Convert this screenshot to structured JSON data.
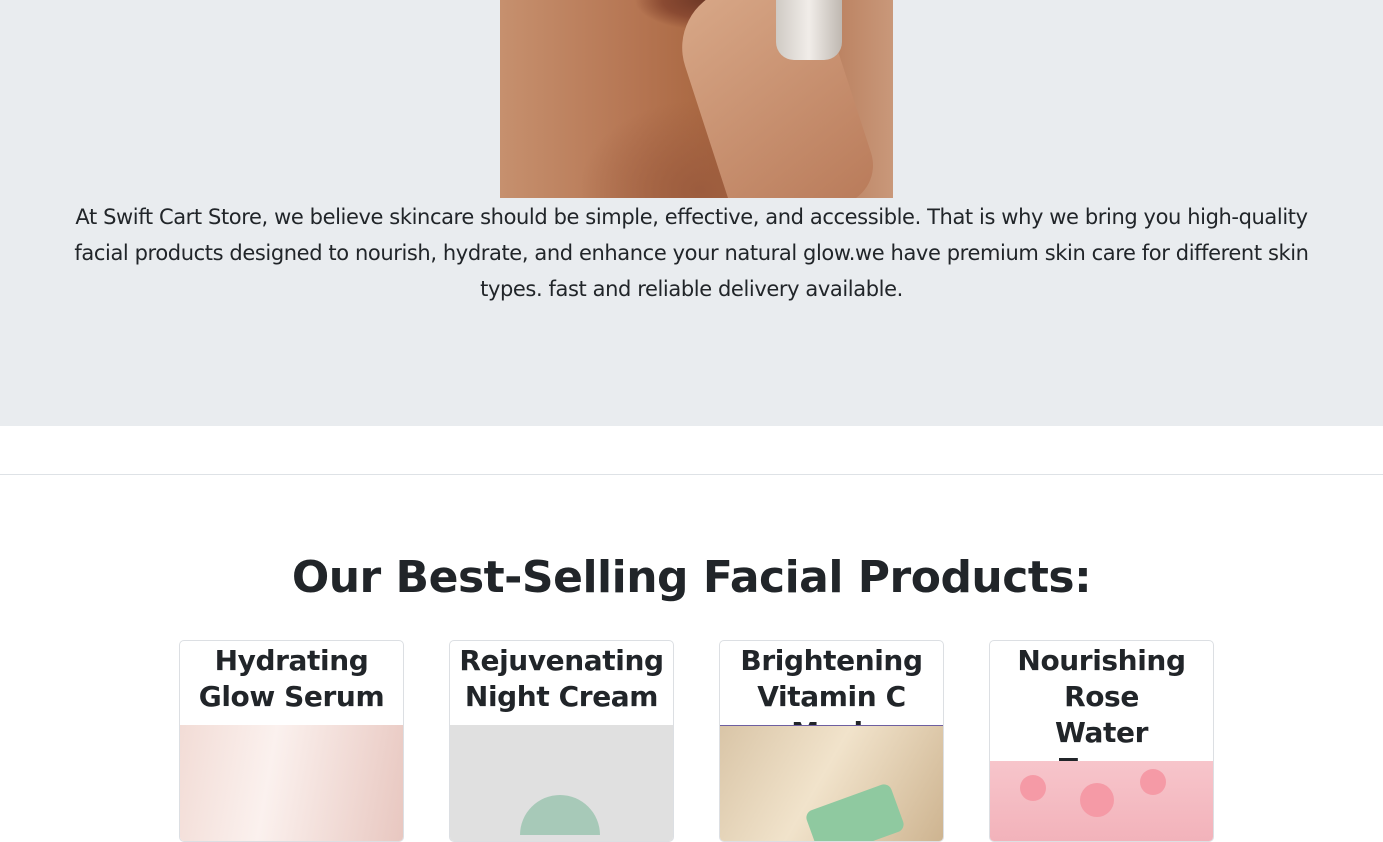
{
  "hero": {
    "text": "At Swift Cart Store, we believe skincare should be simple, effective, and accessible. That is why we bring you high-quality facial products designed to nourish, hydrate, and enhance your natural glow.we have premium skin care for different skin types. fast and reliable delivery available."
  },
  "products": {
    "title": "Our Best-Selling Facial Products:",
    "items": [
      {
        "name": "Hydrating Glow Serum"
      },
      {
        "name": "Rejuvenating Night Cream"
      },
      {
        "name": "Brightening Vitamin C Mask"
      },
      {
        "name": "Nourishing Rose Water Toner"
      }
    ]
  },
  "colors": {
    "hero_background": "#e9ecef",
    "text": "#212529",
    "divider": "#dee2e6"
  }
}
